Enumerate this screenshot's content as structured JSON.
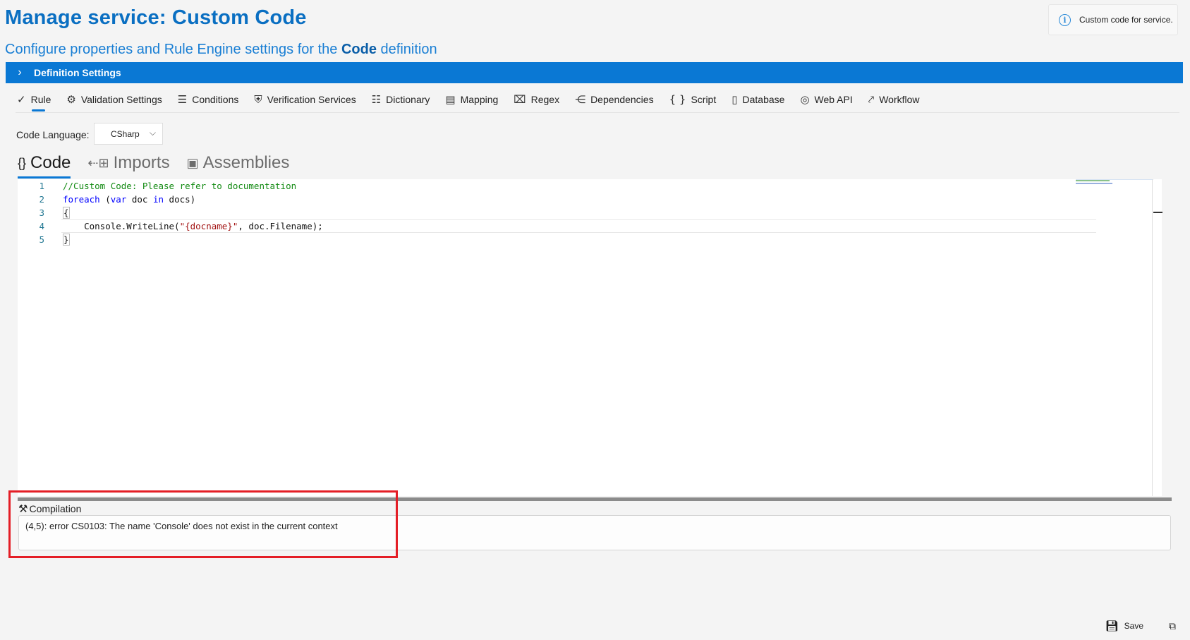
{
  "header": {
    "title": "Manage service:  Custom Code",
    "subtitle_prefix": "Configure properties and Rule Engine settings for the ",
    "subtitle_bold": "Code",
    "subtitle_suffix": " definition"
  },
  "info": {
    "text": "Custom code for service.",
    "icon": "info-icon"
  },
  "definition_bar": {
    "label": "Definition Settings",
    "icon": "chevron-right-icon"
  },
  "toolbar": {
    "items": [
      {
        "label": "Rule",
        "icon": "check-icon",
        "active": true
      },
      {
        "label": "Validation Settings",
        "icon": "settings-validation-icon"
      },
      {
        "label": "Conditions",
        "icon": "list-icon"
      },
      {
        "label": "Verification Services",
        "icon": "shield-icon"
      },
      {
        "label": "Dictionary",
        "icon": "dictionary-icon"
      },
      {
        "label": "Mapping",
        "icon": "mapping-icon"
      },
      {
        "label": "Regex",
        "icon": "regex-icon"
      },
      {
        "label": "Dependencies",
        "icon": "dependencies-icon"
      },
      {
        "label": "Script",
        "icon": "braces-icon"
      },
      {
        "label": "Database",
        "icon": "database-icon"
      },
      {
        "label": "Web API",
        "icon": "web-api-icon"
      },
      {
        "label": "Workflow",
        "icon": "workflow-icon"
      }
    ]
  },
  "language": {
    "label": "Code Language:",
    "value": "CSharp"
  },
  "tabs": [
    {
      "label": "Code",
      "icon": "braces-icon",
      "active": true
    },
    {
      "label": "Imports",
      "icon": "imports-icon"
    },
    {
      "label": "Assemblies",
      "icon": "assemblies-icon"
    }
  ],
  "editor": {
    "lines": [
      {
        "num": "1",
        "text": "//Custom Code: Please refer to documentation"
      },
      {
        "num": "2",
        "text": "foreach (var doc in docs)"
      },
      {
        "num": "3",
        "text": "{"
      },
      {
        "num": "4",
        "text": "    Console.WriteLine(\"{docname}\", doc.Filename);"
      },
      {
        "num": "5",
        "text": "}"
      }
    ]
  },
  "compilation": {
    "title": "Compilation",
    "message": "(4,5): error CS0103: The name 'Console' does not exist in the current context"
  },
  "footer": {
    "save_label": "Save"
  },
  "colors": {
    "accent": "#0a78d4",
    "title": "#0a6fc2",
    "highlight": "#e41e26"
  }
}
